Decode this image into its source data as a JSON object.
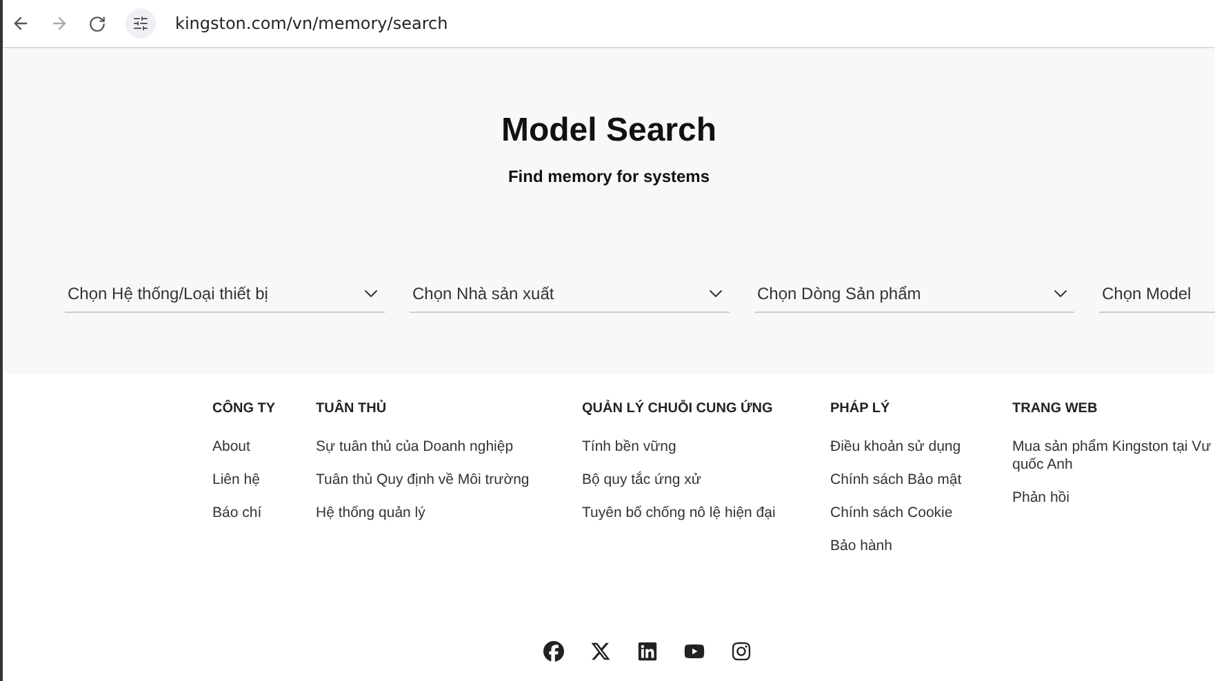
{
  "browser": {
    "url": "kingston.com/vn/memory/search"
  },
  "header": {
    "title": "Model Search",
    "subtitle": "Find memory for systems"
  },
  "selects": [
    {
      "placeholder": "Chọn Hệ thống/Loại thiết bị"
    },
    {
      "placeholder": "Chọn Nhà sản xuất"
    },
    {
      "placeholder": "Chọn Dòng Sản phẩm"
    },
    {
      "placeholder": "Chọn Model"
    }
  ],
  "footer": {
    "columns": [
      {
        "heading": "CÔNG TY",
        "links": [
          [
            "About"
          ],
          [
            "Liên hệ"
          ],
          [
            "Báo chí"
          ]
        ]
      },
      {
        "heading": "TUÂN THỦ",
        "links": [
          [
            "Sự tuân thủ của Doanh nghiệp"
          ],
          [
            "Tuân thủ Quy định về Môi trường"
          ],
          [
            "Hệ thống quản lý"
          ]
        ]
      },
      {
        "heading": "QUẢN LÝ CHUỖI CUNG ỨNG",
        "links": [
          [
            "Tính bền vững"
          ],
          [
            "Bộ quy tắc ứng xử"
          ],
          [
            "Tuyên bố chống nô lệ hiện đại"
          ]
        ]
      },
      {
        "heading": "PHÁP LÝ",
        "links": [
          [
            "Điều khoản sử dụng"
          ],
          [
            "Chính sách Bảo mật"
          ],
          [
            "Chính sách Cookie"
          ],
          [
            "Bảo hành"
          ]
        ]
      },
      {
        "heading": "TRANG WEB",
        "links": [
          [
            "Mua sản phẩm Kingston tại Vư",
            "quốc Anh"
          ],
          [
            "Phản hồi"
          ]
        ]
      }
    ],
    "social": [
      {
        "kind": "facebook"
      },
      {
        "kind": "x"
      },
      {
        "kind": "linkedin"
      },
      {
        "kind": "youtube"
      },
      {
        "kind": "instagram"
      }
    ]
  }
}
